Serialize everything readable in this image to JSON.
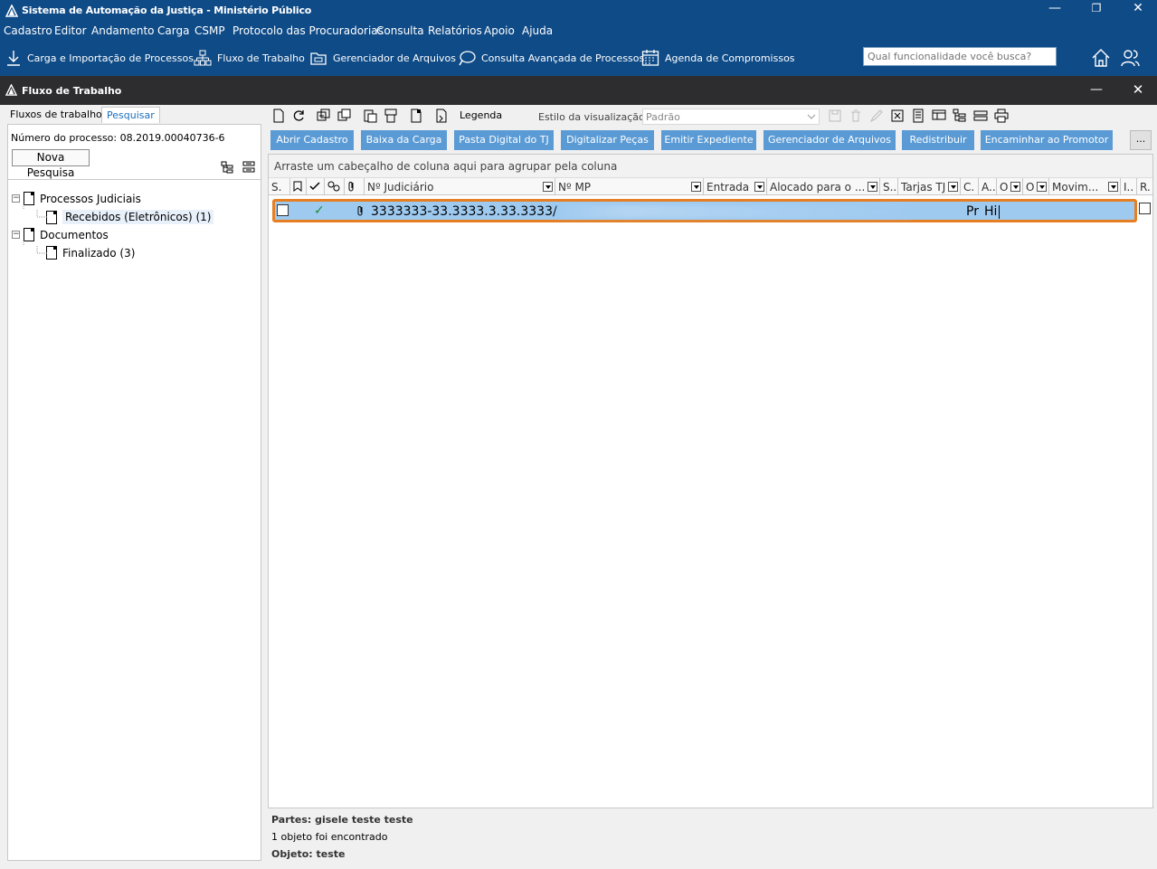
{
  "app": {
    "title": "Sistema de Automação da Justiça - Ministério Público",
    "controls": {
      "minimize": "—",
      "restore": "❐",
      "close": "✕"
    }
  },
  "menu": [
    "Cadastro",
    "Editor",
    "Andamento",
    "Carga",
    "CSMP",
    "Protocolo das Procuradorias",
    "Consulta",
    "Relatórios",
    "Apoio",
    "Ajuda"
  ],
  "quickbar": {
    "items": [
      {
        "label": "Carga e Importação de Processos",
        "icon": "download-icon"
      },
      {
        "label": "Fluxo de Trabalho",
        "icon": "workflow-icon"
      },
      {
        "label": "Gerenciador de Arquivos",
        "icon": "folder-icon"
      },
      {
        "label": "Consulta Avançada de Processos",
        "icon": "chat-search-icon"
      },
      {
        "label": "Agenda de Compromissos",
        "icon": "calendar-icon"
      }
    ],
    "search_placeholder": "Qual funcionalidade você busca?"
  },
  "subwindow": {
    "title": "Fluxo de Trabalho",
    "controls": {
      "minimize": "—",
      "close": "✕"
    }
  },
  "left": {
    "tabs": [
      {
        "label": "Fluxos de trabalho",
        "active": false
      },
      {
        "label": "Pesquisar",
        "active": true
      }
    ],
    "process_number": "Número do processo: 08.2019.00040736-6",
    "new_search": "Nova Pesquisa",
    "tree": [
      {
        "label": "Processos Judiciais",
        "level": 0,
        "expander": "−"
      },
      {
        "label": "Recebidos (Eletrônicos) (1)",
        "level": 1,
        "selected": true
      },
      {
        "label": "Documentos",
        "level": 0,
        "expander": "−"
      },
      {
        "label": "Finalizado (3)",
        "level": 1
      }
    ]
  },
  "right": {
    "legend_label": "Legenda",
    "view_style_label": "Estilo da visualização",
    "view_style_value": "Padrão",
    "actions": [
      "Abrir Cadastro",
      "Baixa da Carga",
      "Pasta Digital do TJ",
      "Digitalizar Peças",
      "Emitir Expediente",
      "Gerenciador de Arquivos",
      "Redistribuir",
      "Encaminhar ao Promotor",
      "..."
    ],
    "group_hint": "Arraste um cabeçalho de coluna aqui para agrupar pela coluna",
    "columns": [
      "S.",
      "",
      "",
      "",
      "",
      "Nº Judiciário",
      "Nº MP",
      "Entrada",
      "Alocado para o ...",
      "S..",
      "Tarjas TJ",
      "C.",
      "A..",
      "O",
      "O",
      "Movim...",
      "I..",
      "R."
    ],
    "row": {
      "check": "✓",
      "judicial_number": "3333333-33.3333.3.33.3333/",
      "col_c": "Pr",
      "col_a": "Hi"
    }
  },
  "status": {
    "parts": "Partes: gisele teste teste",
    "count": "1 objeto foi encontrado",
    "object": "Objeto: teste"
  },
  "colors": {
    "titlebar": "#0f4b87",
    "subtitle": "#2d2d30",
    "action_button": "#5b9bd5",
    "row_selected": "#9fcaf0",
    "highlight": "#e67e22"
  }
}
